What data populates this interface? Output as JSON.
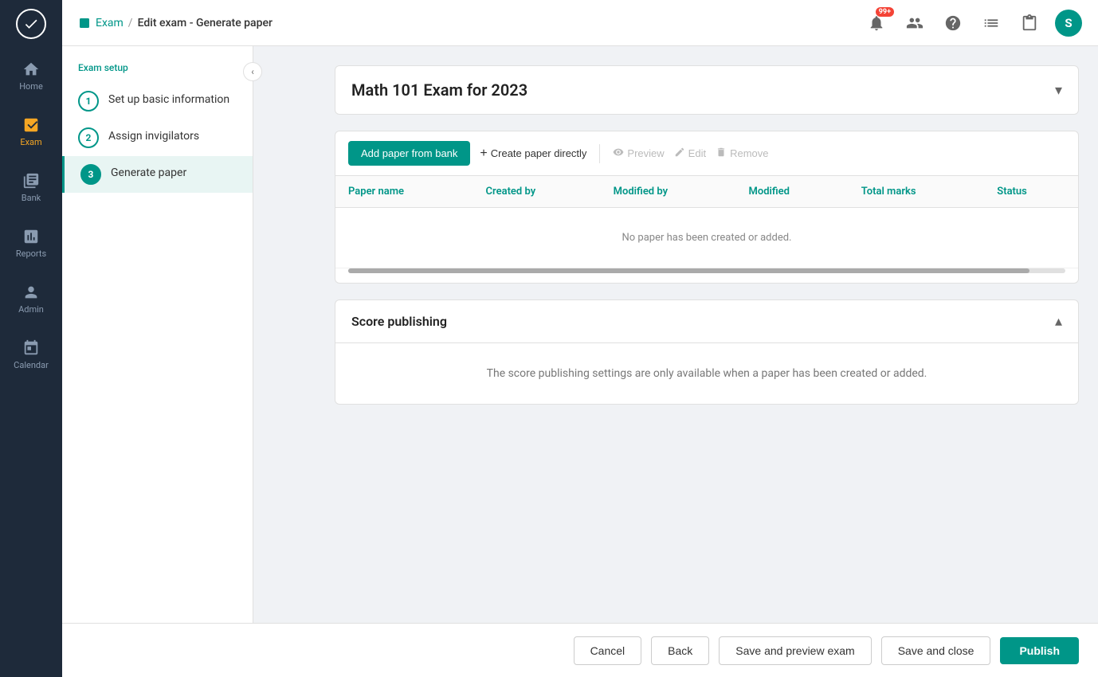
{
  "app": {
    "logo_letter": "✓"
  },
  "sidebar": {
    "items": [
      {
        "id": "home",
        "label": "Home",
        "icon": "home"
      },
      {
        "id": "exam",
        "label": "Exam",
        "icon": "exam",
        "active": true
      },
      {
        "id": "bank",
        "label": "Bank",
        "icon": "bank"
      },
      {
        "id": "reports",
        "label": "Reports",
        "icon": "reports"
      },
      {
        "id": "admin",
        "label": "Admin",
        "icon": "admin"
      },
      {
        "id": "calendar",
        "label": "Calendar",
        "icon": "calendar"
      }
    ]
  },
  "topnav": {
    "breadcrumb_link": "Exam",
    "breadcrumb_separator": "/",
    "breadcrumb_current": "Edit exam - Generate paper",
    "notification_badge": "99+",
    "avatar_letter": "S"
  },
  "left_panel": {
    "section_label": "Exam setup",
    "steps": [
      {
        "number": "1",
        "label": "Set up basic information",
        "active": false
      },
      {
        "number": "2",
        "label": "Assign invigilators",
        "active": false
      },
      {
        "number": "3",
        "label": "Generate paper",
        "active": true
      }
    ]
  },
  "exam_title": "Math 101 Exam for 2023",
  "paper_section": {
    "add_paper_btn": "Add paper from bank",
    "create_paper_btn": "Create paper directly",
    "preview_btn": "Preview",
    "edit_btn": "Edit",
    "remove_btn": "Remove",
    "table": {
      "columns": [
        "Paper name",
        "Created by",
        "Modified by",
        "Modified",
        "Total marks",
        "Status"
      ],
      "no_data_message": "No paper has been created or added."
    }
  },
  "score_section": {
    "title": "Score publishing",
    "body_message": "The score publishing settings are only available when a paper has been created or added."
  },
  "bottom_bar": {
    "cancel_label": "Cancel",
    "back_label": "Back",
    "save_preview_label": "Save and preview exam",
    "save_close_label": "Save and close",
    "publish_label": "Publish"
  }
}
